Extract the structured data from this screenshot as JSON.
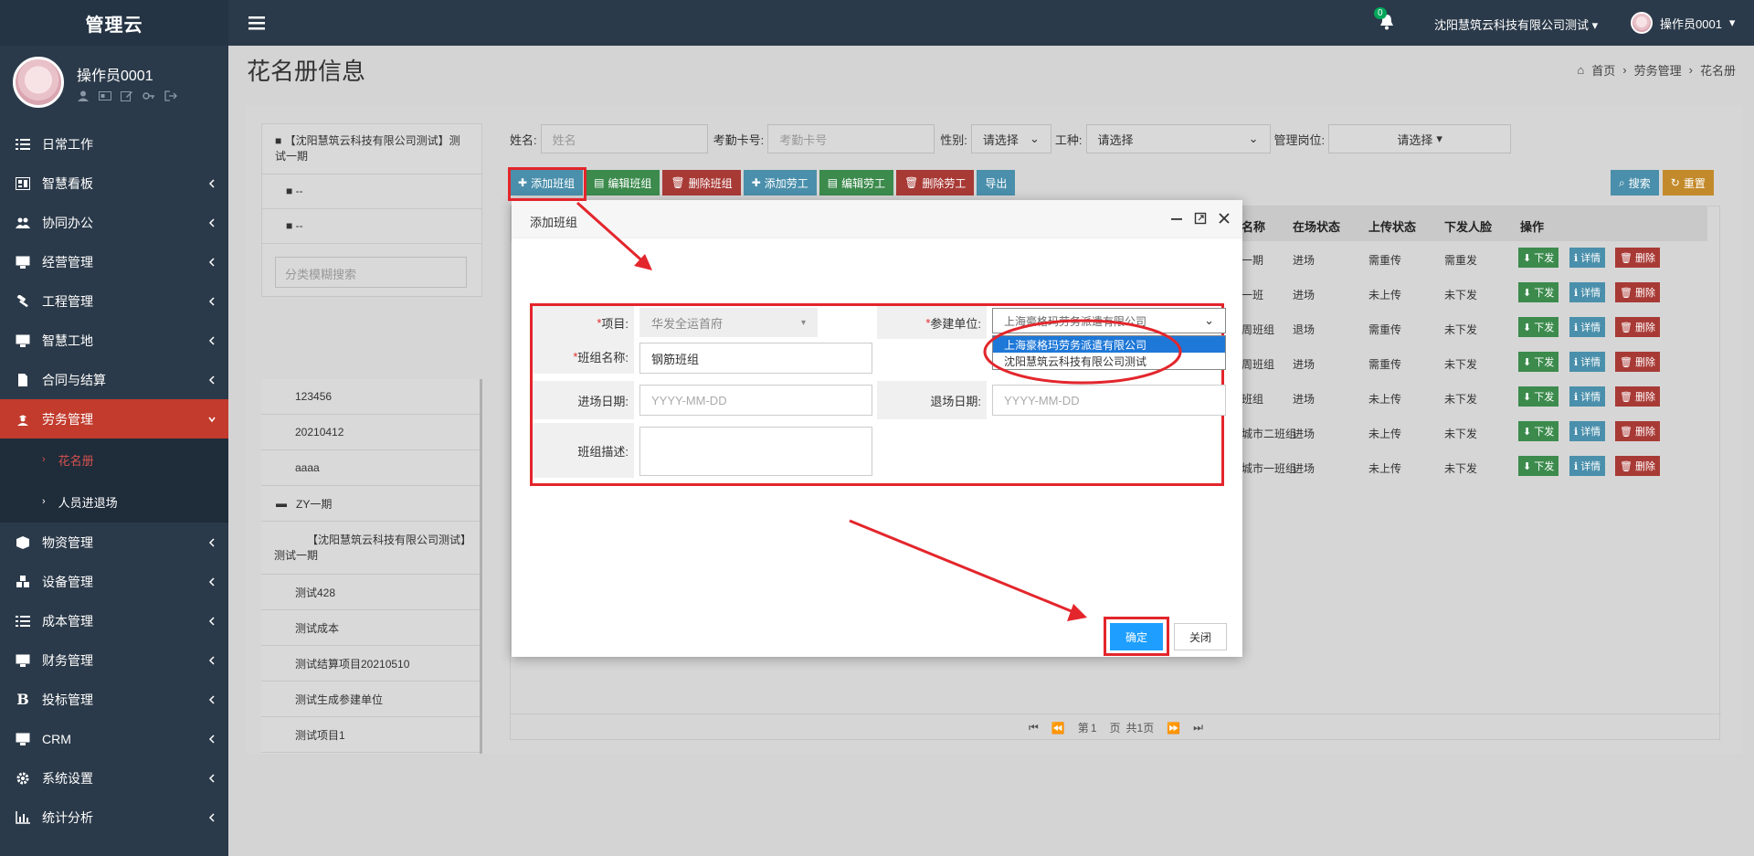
{
  "brand": "管理云",
  "user": {
    "name": "操作员0001"
  },
  "sidebar": {
    "items": [
      {
        "label": "日常工作",
        "icon": "list-icon"
      },
      {
        "label": "智慧看板",
        "icon": "dashboard-icon"
      },
      {
        "label": "协同办公",
        "icon": "users-icon"
      },
      {
        "label": "经营管理",
        "icon": "desktop-icon"
      },
      {
        "label": "工程管理",
        "icon": "hammer-icon"
      },
      {
        "label": "智慧工地",
        "icon": "desktop-icon"
      },
      {
        "label": "合同与结算",
        "icon": "file-icon"
      },
      {
        "label": "劳务管理",
        "icon": "worker-icon"
      },
      {
        "label": "物资管理",
        "icon": "cube-icon"
      },
      {
        "label": "设备管理",
        "icon": "cubes-icon"
      },
      {
        "label": "成本管理",
        "icon": "list-icon"
      },
      {
        "label": "财务管理",
        "icon": "desktop-icon"
      },
      {
        "label": "投标管理",
        "icon": "bold-icon"
      },
      {
        "label": "CRM",
        "icon": "desktop-icon"
      },
      {
        "label": "系统设置",
        "icon": "gear-icon"
      },
      {
        "label": "统计分析",
        "icon": "chart-icon"
      }
    ],
    "submenu": [
      {
        "label": "花名册"
      },
      {
        "label": "人员进退场"
      }
    ]
  },
  "topbar": {
    "notification_count": "0",
    "company": "沈阳慧筑云科技有限公司测试",
    "user": "操作员0001"
  },
  "header": {
    "title": "花名册信息",
    "breadcrumb": [
      "首页",
      "劳务管理",
      "花名册"
    ]
  },
  "tree": {
    "nodes": [
      "【沈阳慧筑云科技有限公司测试】测试一期",
      "--",
      "--"
    ],
    "search_placeholder": "分类模糊搜索"
  },
  "team_list": [
    "123456",
    "20210412",
    "aaaa",
    "ZY一期",
    "【沈阳慧筑云科技有限公司测试】测试一期",
    "测试428",
    "测试成本",
    "测试结算项目20210510",
    "测试生成参建单位",
    "测试项目1"
  ],
  "filters": {
    "name_label": "姓名:",
    "name_placeholder": "姓名",
    "card_label": "考勤卡号:",
    "card_placeholder": "考勤卡号",
    "gender_label": "性别:",
    "gender_value": "请选择",
    "job_label": "工种:",
    "job_value": "请选择",
    "post_label": "管理岗位:",
    "post_value": "请选择"
  },
  "toolbar": {
    "add_team": "添加班组",
    "edit_team": "编辑班组",
    "delete_team": "删除班组",
    "add_worker": "添加劳工",
    "edit_worker": "编辑劳工",
    "delete_worker": "删除劳工",
    "export": "导出",
    "search": "搜索",
    "reset": "重置"
  },
  "table": {
    "headers": [
      "名称",
      "在场状态",
      "上传状态",
      "下发人脸",
      "操作"
    ],
    "rows": [
      {
        "name": "一期",
        "presence": "进场",
        "upload": "需重传",
        "face": "需重发"
      },
      {
        "name": "一班",
        "presence": "进场",
        "upload": "未上传",
        "face": "未下发"
      },
      {
        "name": "周班组",
        "presence": "退场",
        "upload": "需重传",
        "face": "未下发"
      },
      {
        "name": "周班组",
        "presence": "进场",
        "upload": "需重传",
        "face": "未下发"
      },
      {
        "name": "班组",
        "presence": "进场",
        "upload": "未上传",
        "face": "未下发"
      },
      {
        "name": "城市二班组",
        "presence": "进场",
        "upload": "未上传",
        "face": "未下发"
      },
      {
        "name": "城市一班组",
        "presence": "进场",
        "upload": "未上传",
        "face": "未下发"
      }
    ],
    "row_actions": {
      "push": "下发",
      "detail": "详情",
      "delete": "删除"
    },
    "pager": {
      "page_prefix": "第",
      "page": "1",
      "page_suffix": "页",
      "total": "共1页"
    }
  },
  "modal": {
    "title": "添加班组",
    "project_label": "项目:",
    "project_value": "华发全运首府",
    "unit_label": "参建单位:",
    "unit_value": "上海豪格玛劳务派遣有限公司",
    "unit_options": [
      "上海豪格玛劳务派遣有限公司",
      "沈阳慧筑云科技有限公司测试"
    ],
    "team_name_label": "班组名称:",
    "team_name_value": "钢筋班组",
    "entry_date_label": "进场日期:",
    "entry_date_placeholder": "YYYY-MM-DD",
    "exit_date_label": "退场日期:",
    "exit_date_placeholder": "YYYY-MM-DD",
    "desc_label": "班组描述:",
    "ok": "确定",
    "close": "关闭"
  },
  "colors": {
    "sidebar": "#2b3a4a",
    "active": "#c23b2d",
    "annotation": "#e3262c",
    "primary": "#1e9fff"
  }
}
